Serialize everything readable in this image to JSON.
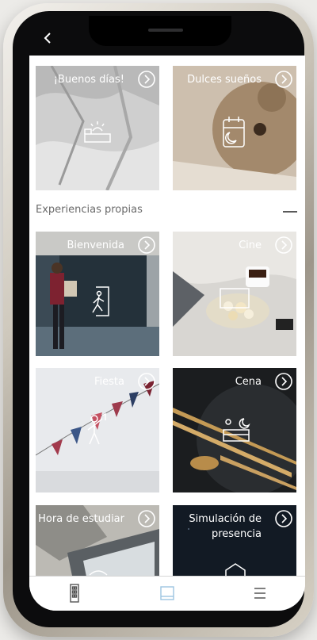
{
  "nav": {
    "back_icon": "chevron-left-icon"
  },
  "top_tiles": [
    {
      "label": "¡Buenos días!",
      "icon": "bed-sunrise-icon"
    },
    {
      "label": "Dulces sueños",
      "icon": "night-calendar-icon"
    }
  ],
  "section": {
    "title": "Experiencias propias",
    "collapse_icon": "minus-icon"
  },
  "tiles": [
    {
      "label": "Bienvenida",
      "icon": "door-enter-icon"
    },
    {
      "label": "Cine",
      "icon": "screen-icon"
    },
    {
      "label": "Fiesta",
      "icon": "party-person-icon"
    },
    {
      "label": "Cena",
      "icon": "dinner-icon"
    },
    {
      "label": "Hora de estudiar",
      "icon": "study-icon"
    },
    {
      "label": "Simulación de presencia",
      "icon": "house-icon"
    }
  ],
  "tabbar": {
    "tabs": [
      {
        "icon": "building-icon",
        "active": false
      },
      {
        "icon": "scene-panel-icon",
        "active": true
      },
      {
        "icon": "menu-icon",
        "active": false
      }
    ],
    "active_color": "#9cc4e0",
    "inactive_color": "#555555"
  }
}
